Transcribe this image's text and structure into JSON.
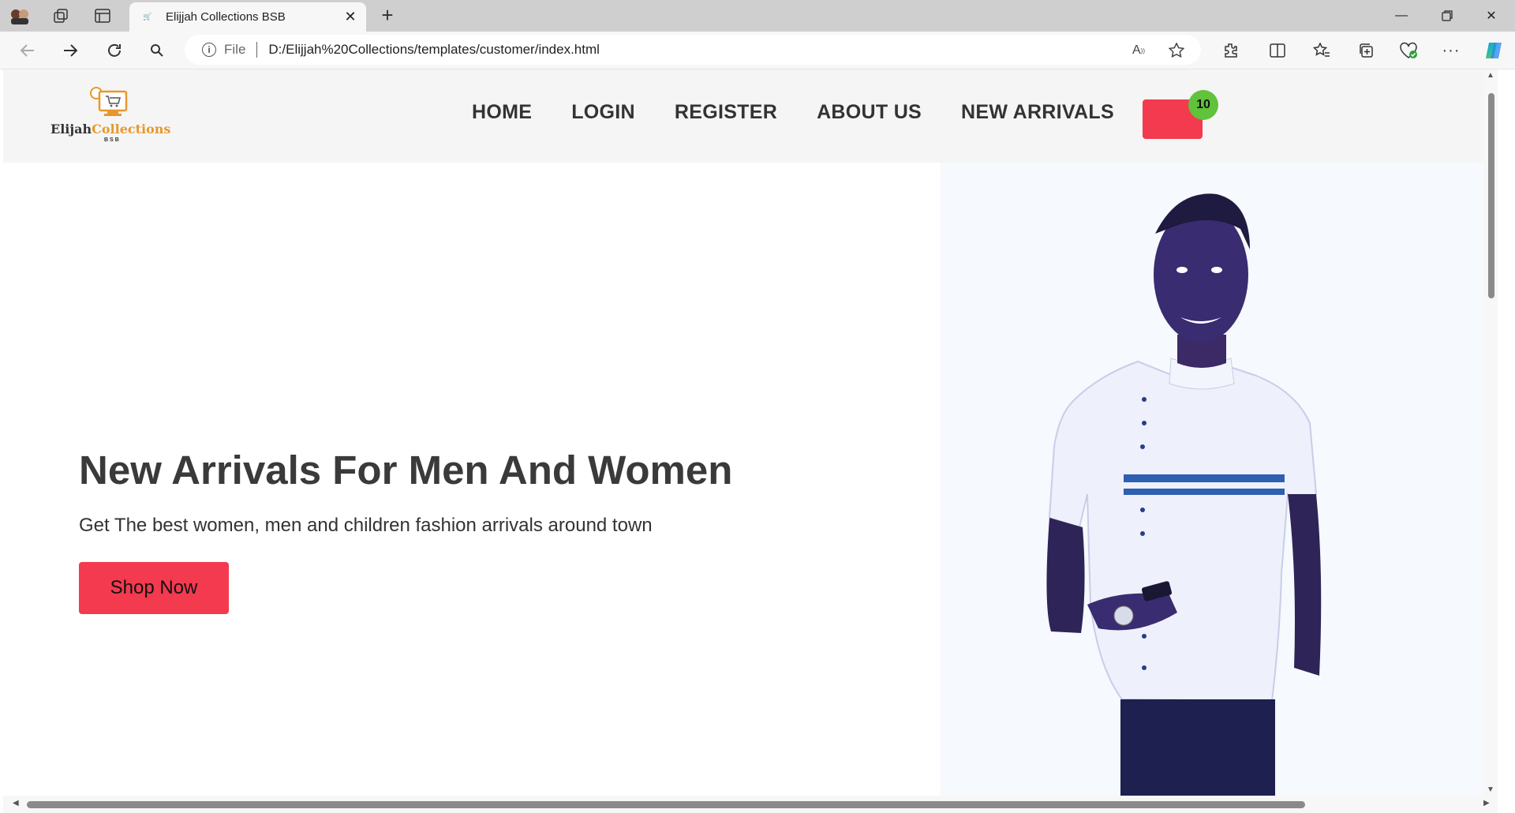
{
  "browser": {
    "tab_title": "Elijjah Collections BSB",
    "url_scheme_label": "File",
    "url": "D:/Elijjah%20Collections/templates/customer/index.html",
    "icons": [
      "profile-icon",
      "workspaces-icon",
      "tab-actions-icon",
      "close-icon",
      "plus-icon",
      "back-icon",
      "forward-icon",
      "refresh-icon",
      "search-icon",
      "info-icon",
      "read-aloud-icon",
      "favorite-star-icon",
      "extensions-icon",
      "split-screen-icon",
      "favorites-icon",
      "collections-icon",
      "browser-essentials-icon",
      "more-icon",
      "copilot-icon"
    ]
  },
  "site": {
    "logo_word1": "Elijah",
    "logo_word2": "Collections",
    "logo_sub": "BSB",
    "nav": [
      "HOME",
      "LOGIN",
      "REGISTER",
      "ABOUT US",
      "NEW ARRIVALS"
    ],
    "cart_count": "10",
    "accent_color": "#f33a4e",
    "badge_color": "#61c23b",
    "logo_color": "#e8982b"
  },
  "hero": {
    "title": "New Arrivals For Men And Women",
    "subtitle": "Get The best women, men and children fashion arrivals around town",
    "cta": "Shop Now"
  }
}
